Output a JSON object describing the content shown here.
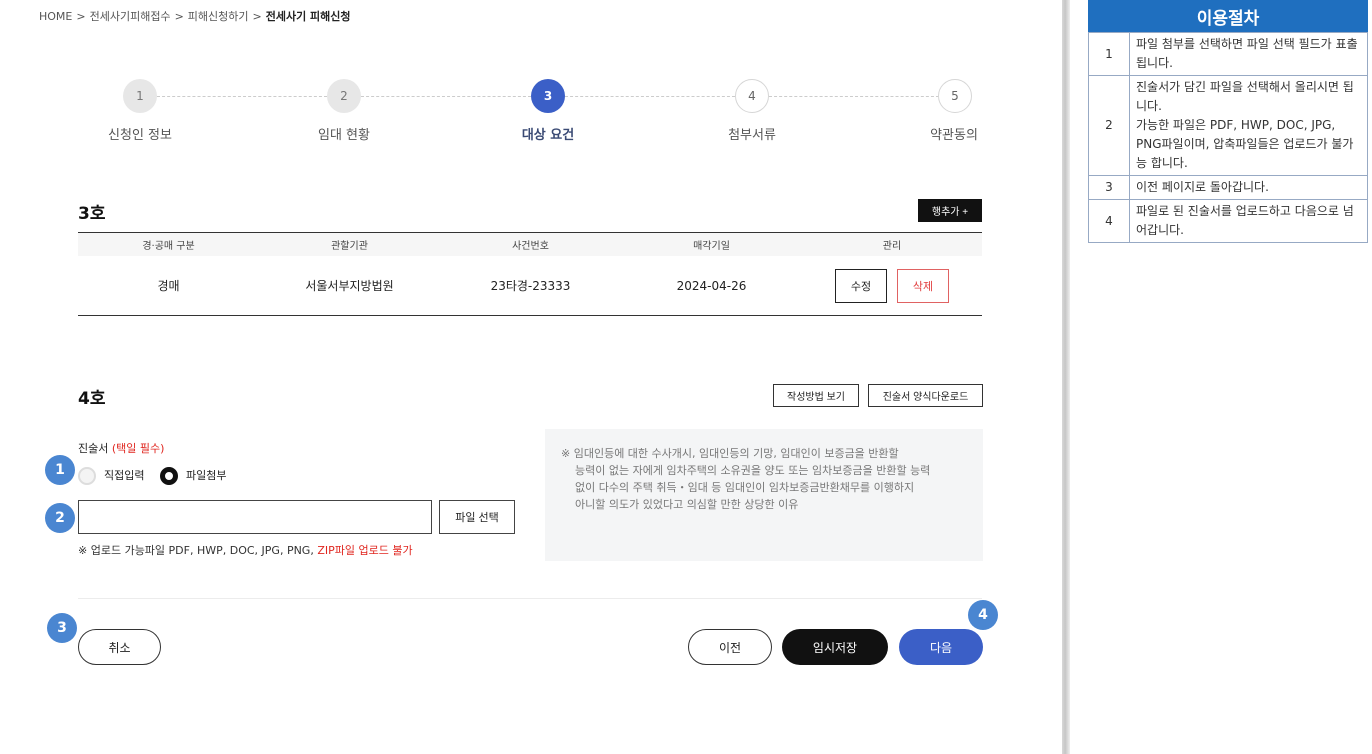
{
  "breadcrumb": {
    "home": "HOME",
    "level1": "전세사기피해접수",
    "level2": "피해신청하기",
    "current": "전세사기 피해신청",
    "separator": ">"
  },
  "steps": [
    {
      "num": "1",
      "label": "신청인 정보",
      "state": "done"
    },
    {
      "num": "2",
      "label": "임대 현황",
      "state": "done"
    },
    {
      "num": "3",
      "label": "대상 요건",
      "state": "active"
    },
    {
      "num": "4",
      "label": "첨부서류",
      "state": "todo"
    },
    {
      "num": "5",
      "label": "약관동의",
      "state": "todo"
    }
  ],
  "section3": {
    "title": "3호",
    "add_row_label": "행추가 +",
    "columns": [
      "경·공매 구분",
      "관할기관",
      "사건번호",
      "매각기일",
      "관리"
    ],
    "rows": [
      {
        "type": "경매",
        "court": "서울서부지방법원",
        "case_no": "23타경-23333",
        "sale_date": "2024-04-26",
        "edit_label": "수정",
        "delete_label": "삭제"
      }
    ]
  },
  "section4": {
    "title": "4호",
    "guide_label": "작성방법 보기",
    "download_label": "진술서 양식다운로드",
    "statement_label": "진술서",
    "statement_required": "(택일 필수)",
    "radio_direct": "직접입력",
    "radio_file": "파일첨부",
    "selected_option": "파일첨부",
    "file_input_value": "",
    "file_select_label": "파일 선택",
    "upload_note": "※ 업로드 가능파일 PDF, HWP, DOC, JPG, PNG,",
    "upload_note_warning": "ZIP파일 업로드 불가",
    "info_lines": [
      "※ 임대인등에 대한 수사개시, 임대인등의 기망, 임대인이 보증금을 반환할",
      "능력이 없는 자에게 임차주택의 소유권을 양도 또는 임차보증금을 반환할 능력",
      "없이 다수의 주택 취득・임대 등 임대인이 임차보증금반환채무를 이행하지",
      "아니할 의도가 있었다고 의심할 만한 상당한 이유"
    ]
  },
  "actions": {
    "cancel": "취소",
    "prev": "이전",
    "temp_save": "임시저장",
    "next": "다음"
  },
  "markers": [
    "1",
    "2",
    "3",
    "4"
  ],
  "procedure": {
    "title": "이용절차",
    "items": [
      {
        "num": "1",
        "text": "파일 첨부를 선택하면 파일 선택 필드가 표출됩니다."
      },
      {
        "num": "2",
        "text": "진술서가 담긴 파일을 선택해서 올리시면 됩니다.\n가능한 파일은 PDF, HWP, DOC, JPG, PNG파일이며, 압축파일들은 업로드가 불가능 합니다."
      },
      {
        "num": "3",
        "text": "이전 페이지로 돌아갑니다."
      },
      {
        "num": "4",
        "text": "파일로 된 진술서를 업로드하고 다음으로 넘어갑니다."
      }
    ]
  },
  "colors": {
    "accent": "#3b5fc7",
    "marker": "#4a86d1",
    "warning": "#e0261f",
    "procedure_header": "#1f6fbf"
  }
}
